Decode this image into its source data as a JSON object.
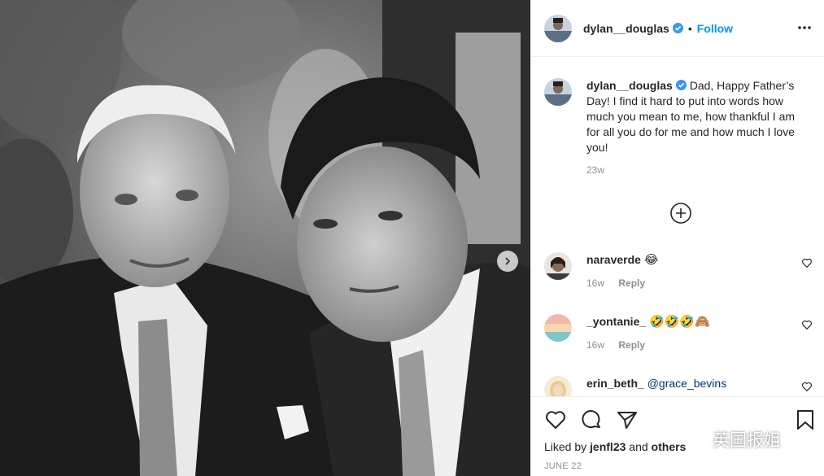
{
  "header": {
    "username": "dylan__douglas",
    "separator": "•",
    "follow_label": "Follow"
  },
  "caption": {
    "username": "dylan__douglas",
    "text": "Dad, Happy Father’s Day! I find it hard to put into words how much you mean to me, how thankful I am for all you do for me and how much I love you!",
    "age": "23w"
  },
  "comments": [
    {
      "username": "naraverde",
      "text": "😂",
      "age": "16w",
      "reply_label": "Reply"
    },
    {
      "username": "_yontanie_",
      "text": "🤣🤣🤣🙈",
      "age": "16w",
      "reply_label": "Reply"
    },
    {
      "username": "erin_beth_",
      "mention": "@grace_bevins"
    }
  ],
  "likes": {
    "prefix": "Liked by ",
    "user": "jenfl23",
    "joiner": " and ",
    "others": "others"
  },
  "date": "JUNE 22",
  "watermark": "英国报姐",
  "colors": {
    "accent": "#0095f6",
    "verified": "#3897f0",
    "text": "#262626",
    "muted": "#8e8e8e",
    "mention": "#00376b"
  },
  "icons": [
    "more-icon",
    "verified-icon",
    "load-more-icon",
    "heart-icon",
    "comment-icon",
    "share-icon",
    "bookmark-icon",
    "chevron-right-icon",
    "wechat-logo"
  ]
}
